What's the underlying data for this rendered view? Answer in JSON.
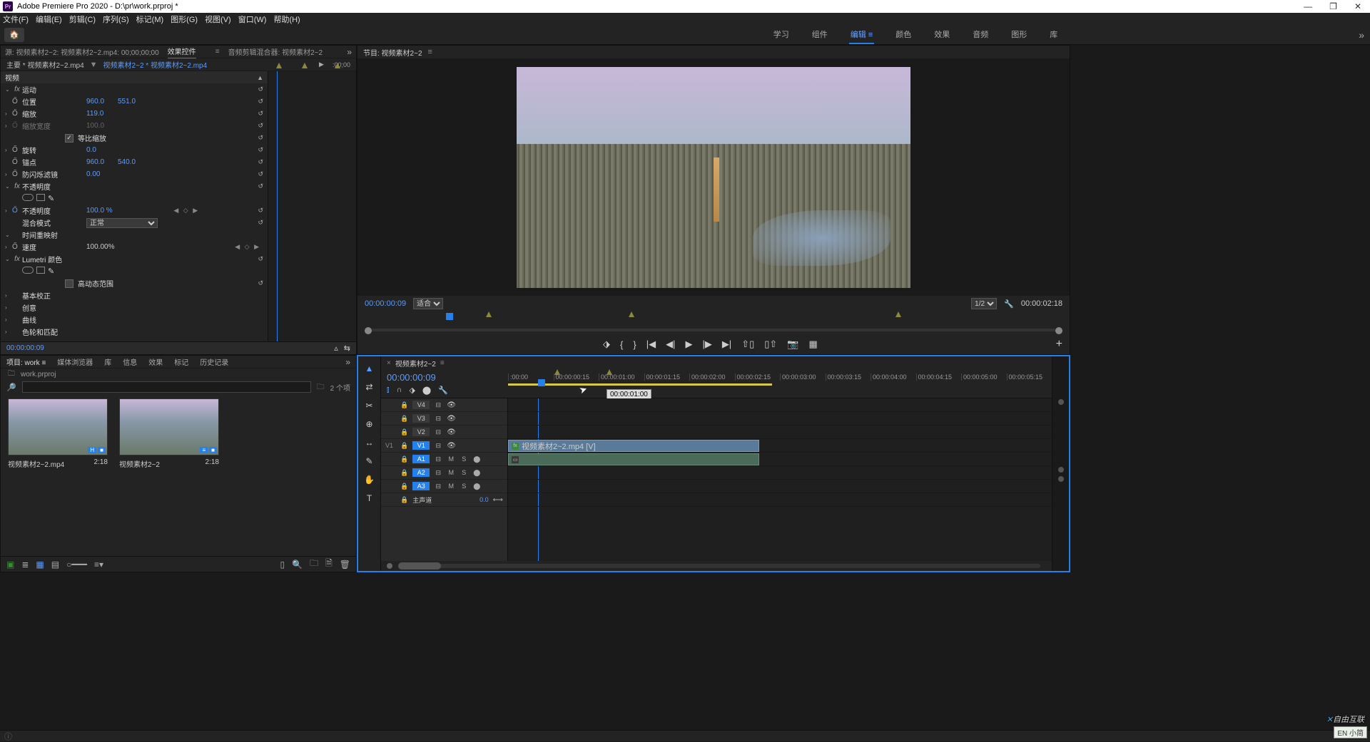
{
  "app": {
    "title": "Adobe Premiere Pro 2020 - D:\\pr\\work.prproj *",
    "icon_label": "Pr"
  },
  "menu": [
    "文件(F)",
    "编辑(E)",
    "剪辑(C)",
    "序列(S)",
    "标记(M)",
    "图形(G)",
    "视图(V)",
    "窗口(W)",
    "帮助(H)"
  ],
  "workspaces": {
    "items": [
      "学习",
      "组件",
      "编辑",
      "颜色",
      "效果",
      "音频",
      "图形",
      "库"
    ],
    "active_index": 2
  },
  "source_tabs": {
    "items": [
      "源: 视频素材2~2: 视频素材2~2.mp4: 00;00;00;00",
      "效果控件",
      "音频剪辑混合器: 视频素材2~2"
    ],
    "active_index": 1
  },
  "effect_controls": {
    "master": "主要 * 视频素材2~2.mp4",
    "clip_path": "视频素材2~2 * 视频素材2~2.mp4",
    "time_start": ":00;00",
    "clip_label": "视频素材2~2.mp4",
    "video_header": "视频",
    "motion": {
      "label": "运动",
      "position": {
        "label": "位置",
        "x": "960.0",
        "y": "551.0"
      },
      "scale": {
        "label": "缩放",
        "value": "119.0"
      },
      "scale_w": {
        "label": "缩放宽度",
        "value": "100.0"
      },
      "uniform": {
        "label": "等比缩放",
        "checked": true
      },
      "rotation": {
        "label": "旋转",
        "value": "0.0"
      },
      "anchor": {
        "label": "锚点",
        "x": "960.0",
        "y": "540.0"
      },
      "flicker": {
        "label": "防闪烁滤镜",
        "value": "0.00"
      }
    },
    "opacity": {
      "label": "不透明度",
      "value": "100.0 %",
      "blend_label": "混合模式",
      "blend_value": "正常"
    },
    "remap": {
      "label": "时间重映射",
      "speed_label": "速度",
      "speed_value": "100.00%"
    },
    "lumetri": {
      "label": "Lumetri 颜色",
      "hdr_label": "高动态范围"
    },
    "items": [
      "基本校正",
      "创意",
      "曲线",
      "色轮和匹配"
    ],
    "footer_tc": "00:00:00:09"
  },
  "program": {
    "title": "节目: 视频素材2~2",
    "tc": "00:00:00:09",
    "fit": "适合",
    "res": "1/2",
    "duration": "00:00:02:18"
  },
  "project": {
    "tabs": [
      "项目: work",
      "媒体浏览器",
      "库",
      "信息",
      "效果",
      "标记",
      "历史记录"
    ],
    "project_name": "work.prproj",
    "item_count": "2 个项",
    "thumbs": [
      {
        "name": "视频素材2~2.mp4",
        "dur": "2:18"
      },
      {
        "name": "视频素材2~2",
        "dur": "2:18"
      }
    ]
  },
  "tools": [
    "▲",
    "⇄",
    "✂",
    "⊕",
    "↔",
    "✎",
    "✋",
    "T"
  ],
  "timeline": {
    "title": "视频素材2~2",
    "tc": "00:00:00:09",
    "tooltip": "00:00:01:00",
    "ruler": [
      ":00:00",
      "00:00:00:15",
      "00:00:01:00",
      "00:00:01:15",
      "00:00:02:00",
      "00:00:02:15",
      "00:00:03:00",
      "00:00:03:15",
      "00:00:04:00",
      "00:00:04:15",
      "00:00:05:00",
      "00:00:05:15"
    ],
    "video_tracks": [
      "V4",
      "V3",
      "V2",
      "V1"
    ],
    "audio_tracks": [
      "A1",
      "A2",
      "A3"
    ],
    "master": "主声道",
    "master_val": "0.0",
    "clip_label": "视频素材2~2.mp4 [V]",
    "side_label": "V1"
  },
  "watermark": "自由互联",
  "ime": "EN 小简"
}
